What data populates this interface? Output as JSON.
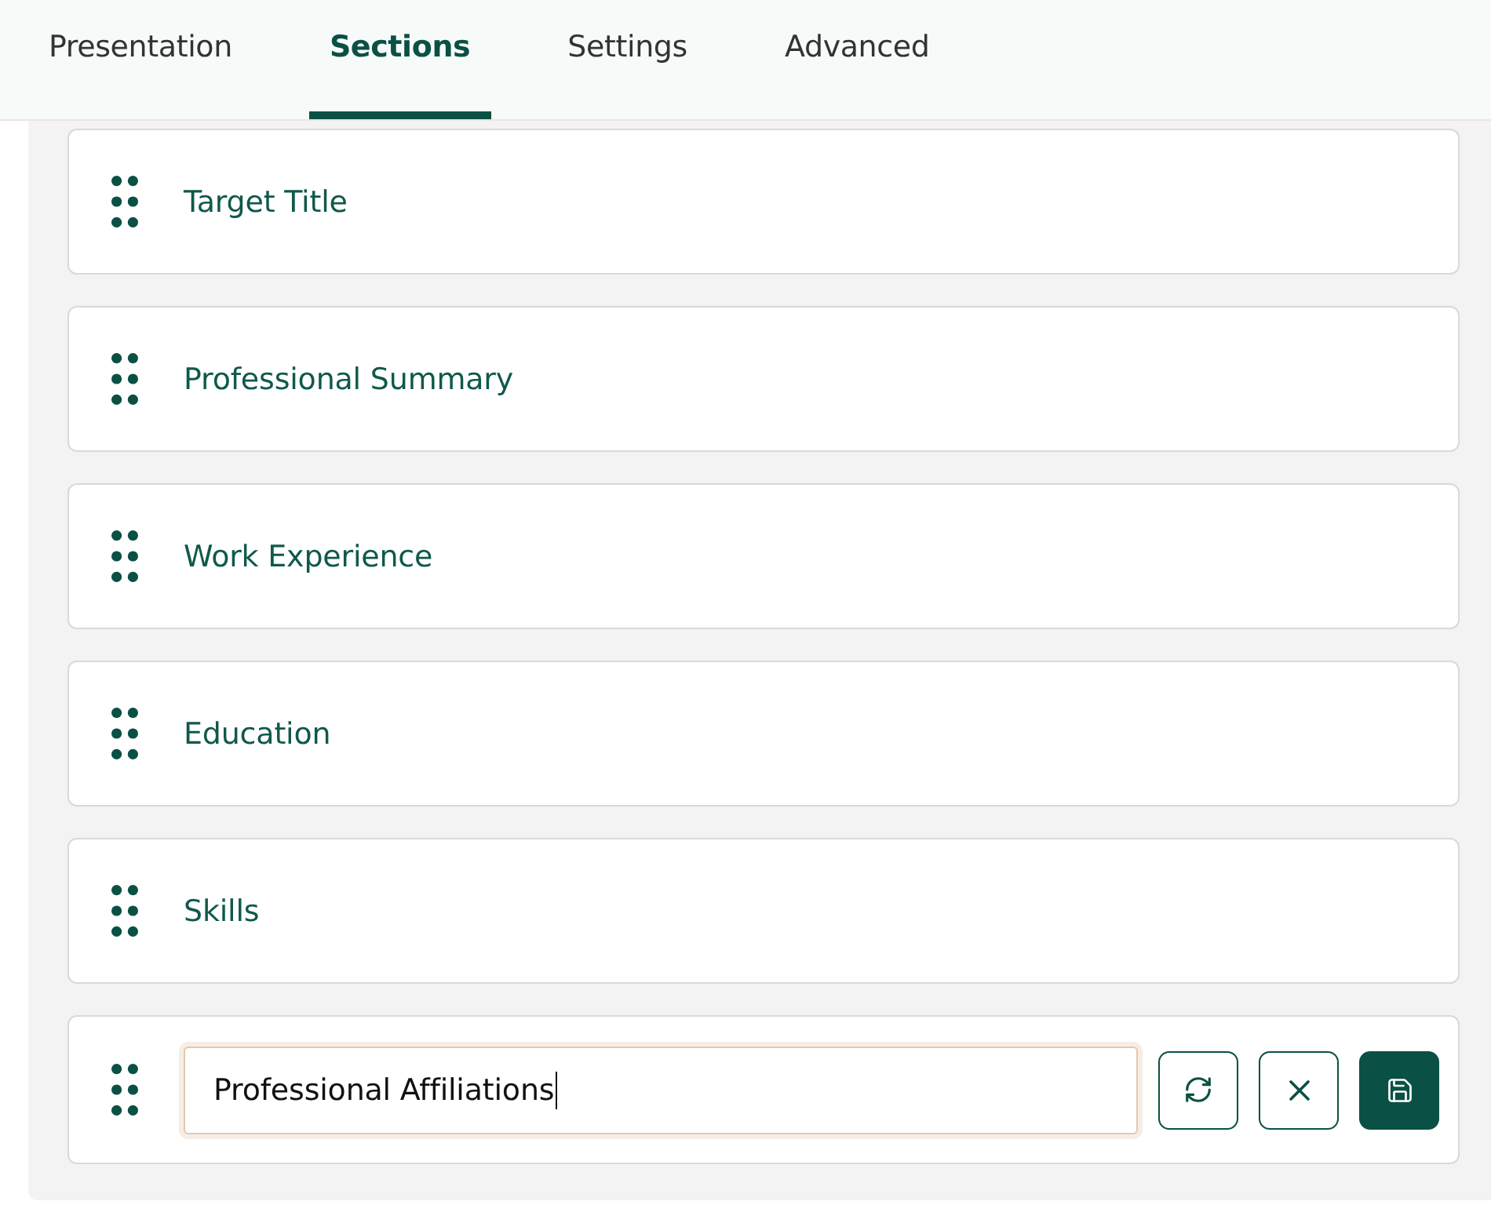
{
  "tabs": [
    {
      "label": "Presentation",
      "selected": false
    },
    {
      "label": "Sections",
      "selected": true
    },
    {
      "label": "Settings",
      "selected": false
    },
    {
      "label": "Advanced",
      "selected": false
    }
  ],
  "sections": [
    {
      "kind": "item",
      "label": "Target Title"
    },
    {
      "kind": "item",
      "label": "Professional Summary"
    },
    {
      "kind": "item",
      "label": "Work Experience"
    },
    {
      "kind": "item",
      "label": "Education"
    },
    {
      "kind": "item",
      "label": "Skills"
    },
    {
      "kind": "editing",
      "value": "Professional Affiliations",
      "focused": true,
      "actions": [
        {
          "kind": "reset",
          "primary": false
        },
        {
          "kind": "cancel",
          "primary": false
        },
        {
          "kind": "save",
          "primary": true
        }
      ]
    }
  ]
}
